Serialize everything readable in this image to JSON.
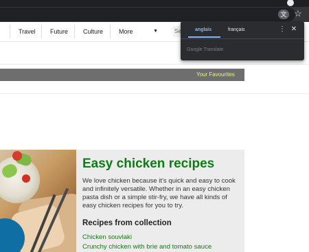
{
  "browser": {
    "translate_icon_glyph": "文",
    "star_glyph": "☆"
  },
  "nav": {
    "items": [
      {
        "label": "Travel"
      },
      {
        "label": "Future"
      },
      {
        "label": "Culture"
      },
      {
        "label": "More"
      }
    ],
    "search_stub": "Se"
  },
  "favourites_band": {
    "text": "Your Favourites"
  },
  "article": {
    "title": "Easy chicken recipes",
    "intro": "We love chicken because it's quick and easy to cook and infinitely versatile. Whether in an easy chicken pasta dish or a simple stir-fry, we have all kinds of easy chicken recipes for you to try.",
    "collection_heading": "Recipes from collection",
    "links": [
      {
        "label": "Chicken souvlaki"
      },
      {
        "label": "Crunchy chicken with brie and tomato sauce"
      }
    ]
  },
  "translate_popup": {
    "tab_active": "anglais",
    "tab_inactive": "français",
    "menu_glyph": "⋮",
    "close_glyph": "✕",
    "footer": "Google Translate"
  },
  "colors": {
    "accent_green": "#0d7d12",
    "favourites_text": "#e8f58a",
    "popup_blue": "#8ab4f8"
  }
}
